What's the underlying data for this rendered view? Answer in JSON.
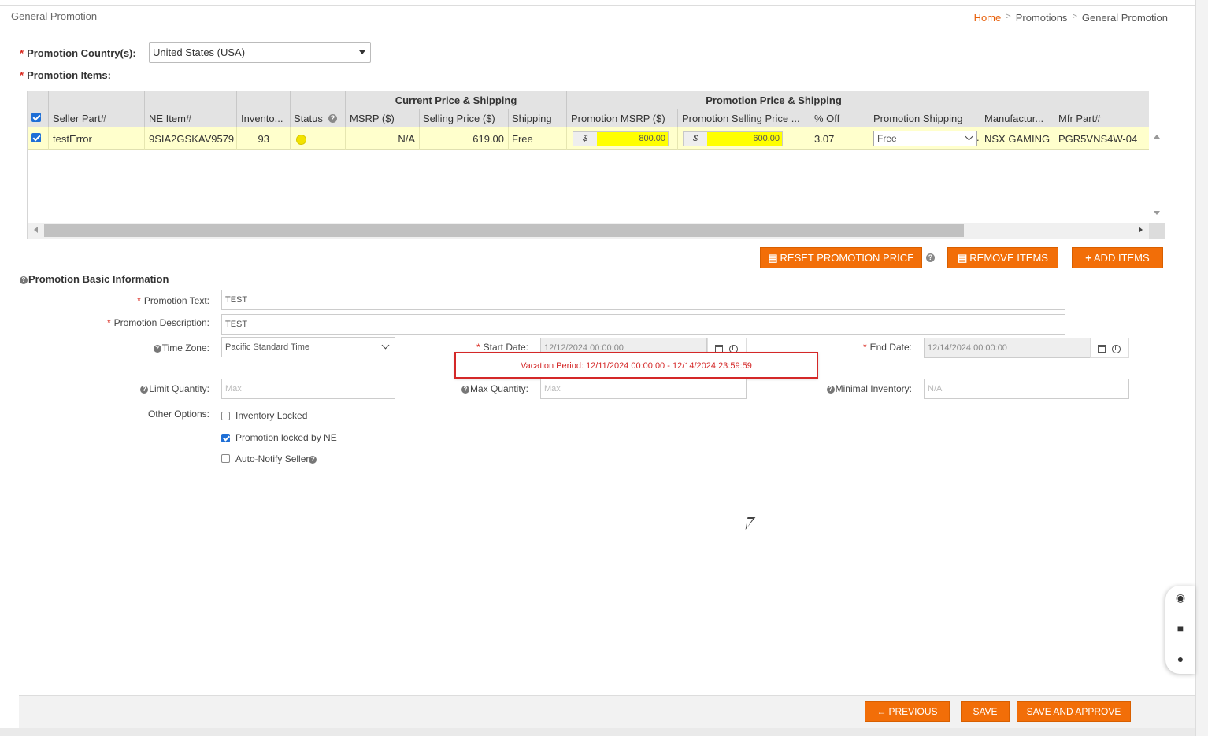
{
  "header": {
    "page_title": "General Promotion",
    "breadcrumb": [
      "Home",
      "Promotions",
      "General Promotion"
    ]
  },
  "country": {
    "label": "Promotion Country(s):",
    "value": "United States (USA)"
  },
  "items_label": "Promotion Items:",
  "grid": {
    "group_current": "Current Price & Shipping",
    "group_promo": "Promotion Price & Shipping",
    "columns": [
      "Seller Part#",
      "NE Item#",
      "Invento...",
      "Status",
      "MSRP ($)",
      "Selling Price ($)",
      "Shipping",
      "Promotion MSRP ($)",
      "Promotion Selling Price ...",
      "% Off",
      "Promotion Shipping",
      "Manufactur...",
      "Mfr Part#"
    ],
    "rows": [
      {
        "seller_part": "testError",
        "ne_item": "9SIA2GSKAV9579",
        "inventory": "93",
        "msrp": "N/A",
        "selling_price": "619.00",
        "shipping": "Free",
        "promo_msrp_currency": "$",
        "promo_msrp": "800.00",
        "promo_selling_currency": "$",
        "promo_selling": "600.00",
        "pct_off": "3.07",
        "promo_shipping": "Free",
        "manufacturer": "NSX GAMING",
        "mfr_part": "PGR5VNS4W-04"
      }
    ]
  },
  "buttons": {
    "reset": "RESET PROMOTION PRICE",
    "remove": "REMOVE ITEMS",
    "add": "ADD ITEMS",
    "previous": "PREVIOUS",
    "save": "SAVE",
    "save_approve": "SAVE AND APPROVE"
  },
  "basic": {
    "title": "Promotion Basic Information",
    "promo_text_label": "Promotion Text:",
    "promo_text_value": "TEST",
    "promo_desc_label": "Promotion Description:",
    "promo_desc_value": "TEST",
    "tz_label": "Time Zone:",
    "tz_value": "Pacific Standard Time",
    "start_label": "Start Date:",
    "start_value": "12/12/2024 00:00:00",
    "end_label": "End Date:",
    "end_value": "12/14/2024 00:00:00",
    "vacation": "Vacation Period: 12/11/2024 00:00:00 - 12/14/2024 23:59:59",
    "limit_label": "Limit Quantity:",
    "limit_placeholder": "Max",
    "max_label": "Max Quantity:",
    "max_placeholder": "Max",
    "min_inv_label": "Minimal Inventory:",
    "min_inv_placeholder": "N/A",
    "other_label": "Other Options:",
    "opt_inventory_locked": "Inventory Locked",
    "opt_locked_by_ne": "Promotion locked by NE",
    "opt_auto_notify": "Auto-Notify Seller"
  },
  "colors": {
    "accent": "#f26e08",
    "error": "#d42828",
    "row_highlight": "#ffffcc",
    "price_highlight": "#ffff00"
  }
}
